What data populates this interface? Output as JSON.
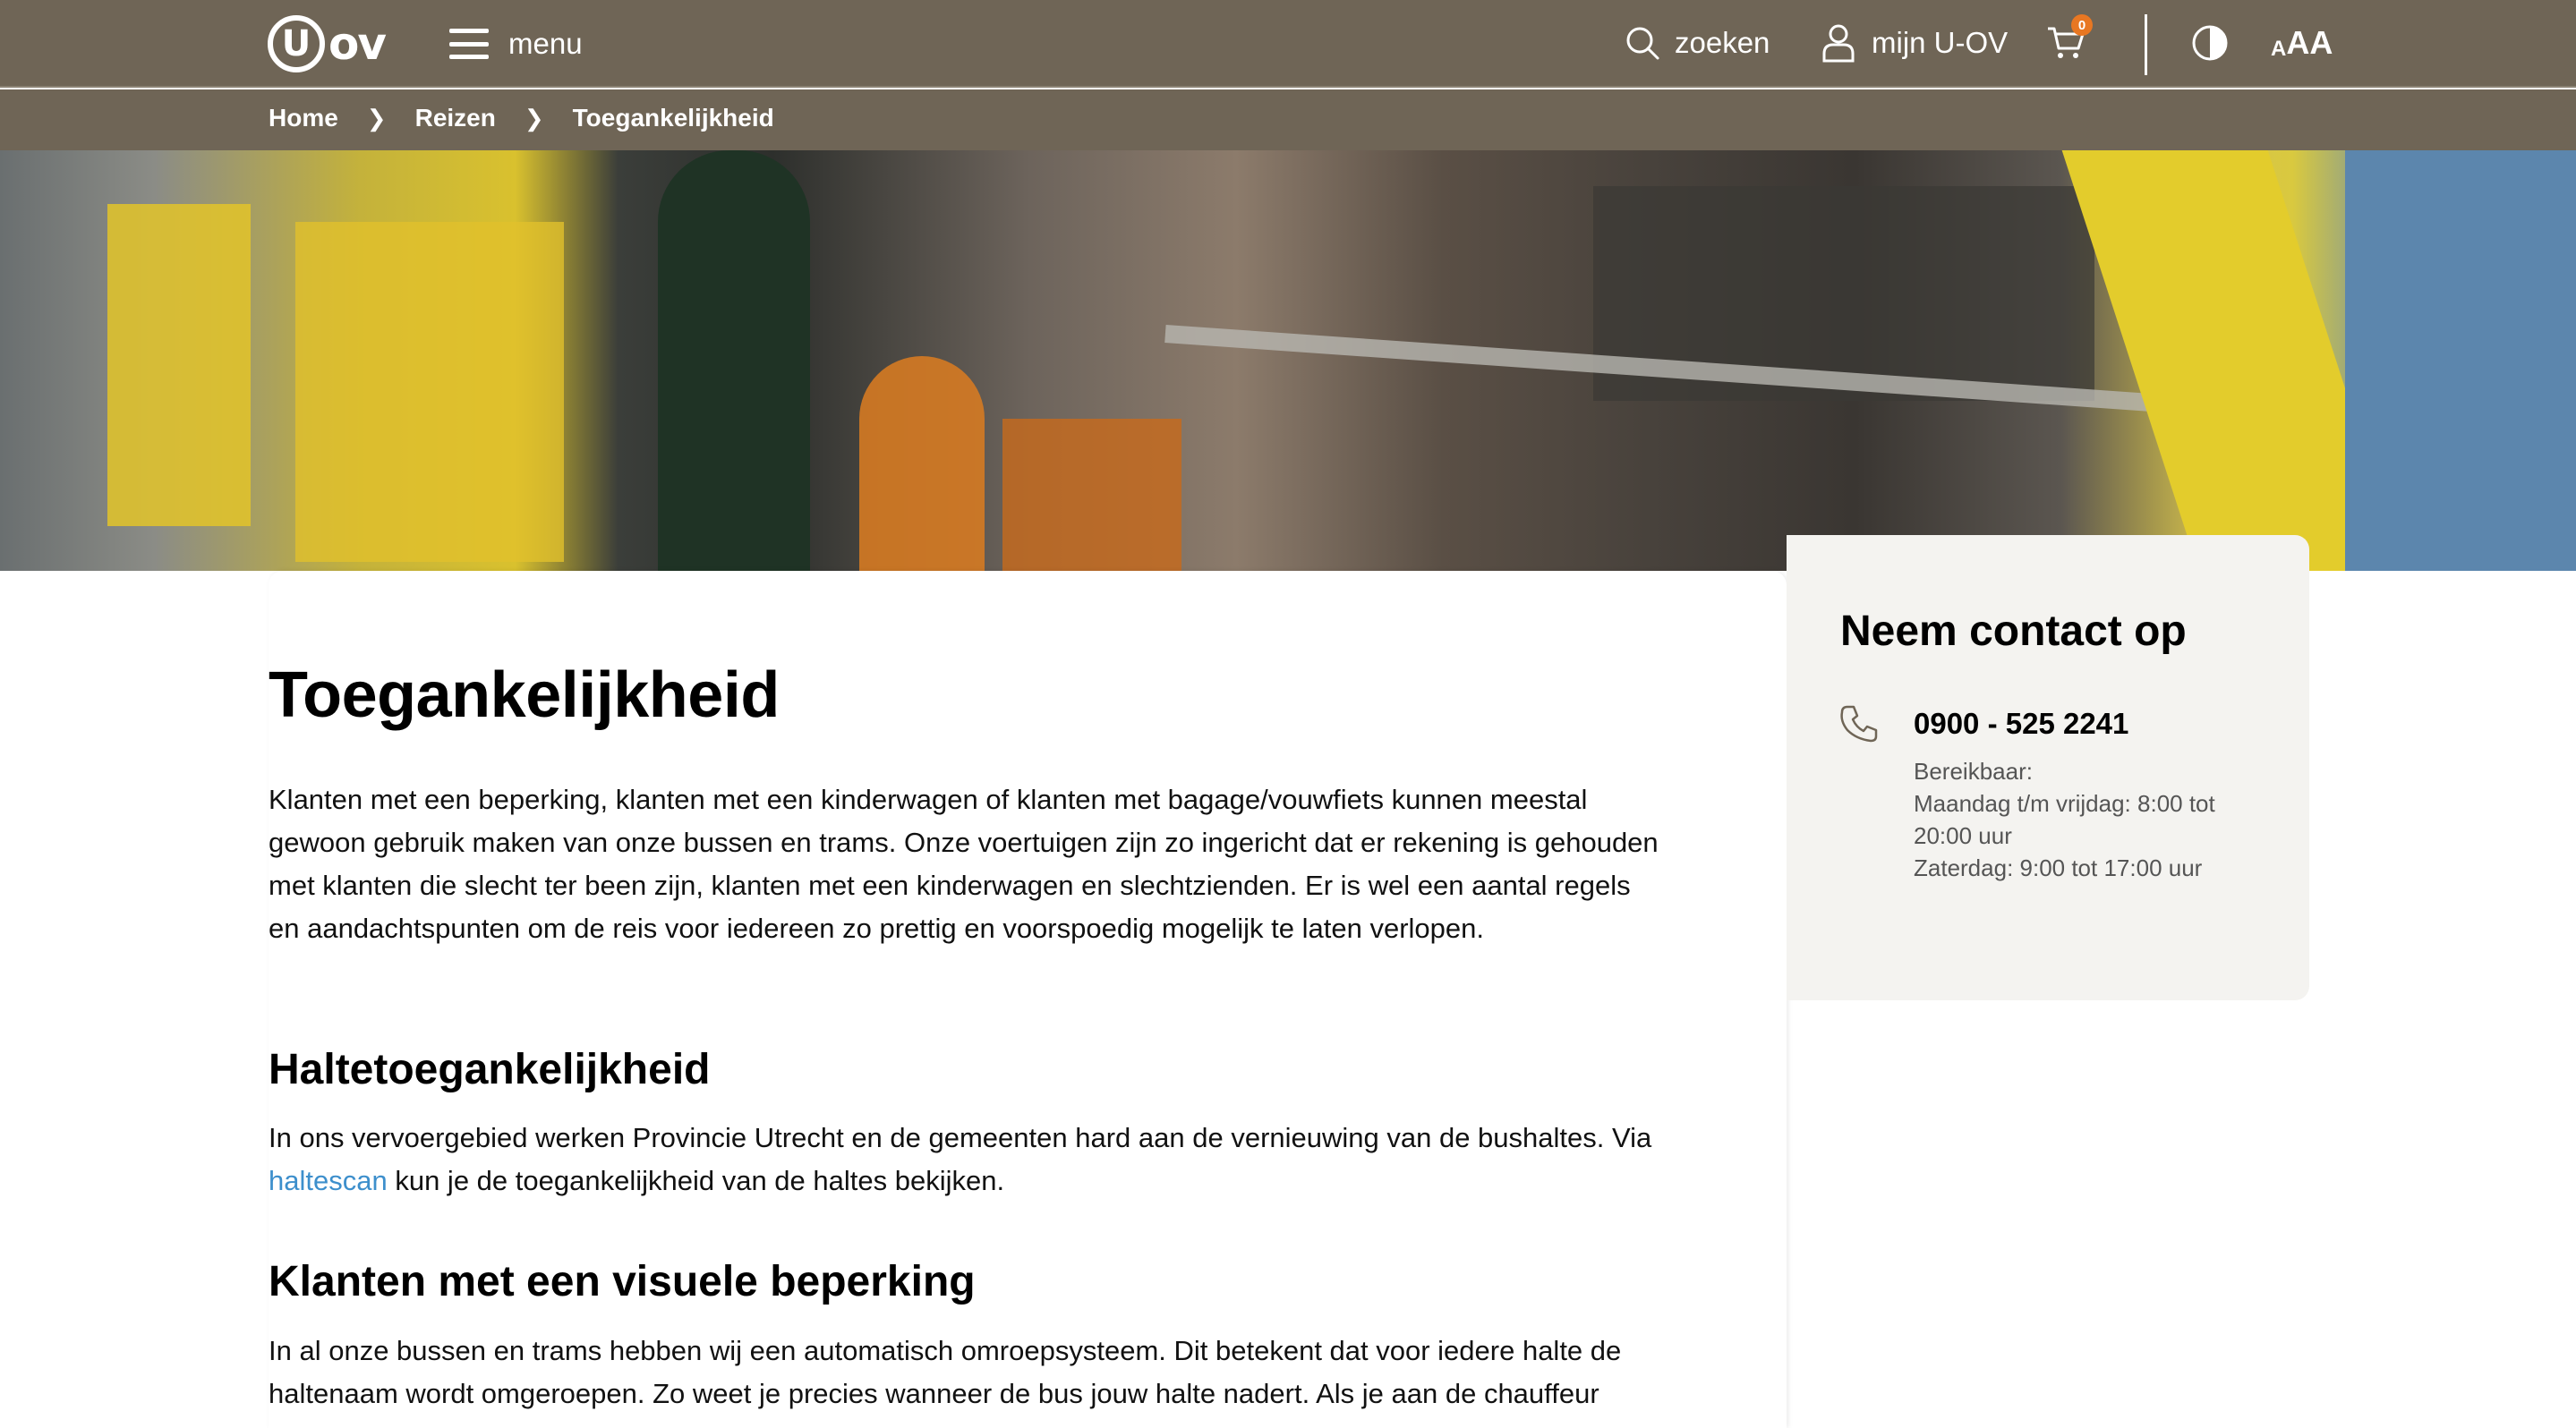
{
  "header": {
    "logo_u": "U",
    "logo_ov": "ov",
    "menu_label": "menu",
    "search_label": "zoeken",
    "account_label": "mijn U-OV",
    "cart_count": "0",
    "text_size_label": "AA",
    "icons": [
      "hamburger-icon",
      "search-icon",
      "user-icon",
      "cart-icon",
      "contrast-icon",
      "text-size-icon"
    ]
  },
  "breadcrumb": {
    "items": [
      "Home",
      "Reizen",
      "Toegankelijkheid"
    ],
    "separator": ">"
  },
  "main": {
    "title": "Toegankelijkheid",
    "intro": "Klanten met een beperking, klanten met een kinderwagen of klanten met bagage/vouwfiets kunnen meestal gewoon gebruik maken van onze bussen en trams. Onze voertuigen zijn zo ingericht dat er rekening is gehouden met klanten die slecht ter been zijn, klanten met een kinderwagen en slechtzienden. Er is wel een aantal regels en aandachtspunten om de reis voor iedereen zo prettig en voorspoedig mogelijk te laten verlopen.",
    "section1": {
      "heading": "Haltetoegankelijkheid",
      "text_before": "In ons vervoergebied werken Provincie Utrecht en de gemeenten hard aan de vernieuwing van de bushaltes. Via ",
      "link": "haltescan",
      "text_after": " kun je de toegankelijkheid van de haltes bekijken."
    },
    "section2": {
      "heading": "Klanten met een visuele beperking",
      "text": "In al onze bussen en trams hebben wij een automatisch omroepsysteem. Dit betekent dat voor iedere halte de haltenaam wordt omgeroepen. Zo weet je precies wanneer de bus jouw halte nadert. Als je aan de chauffeur"
    }
  },
  "contact": {
    "title": "Neem contact op",
    "phone": "0900 - 525 2241",
    "hours_label": "Bereikbaar:",
    "hours_weekdays": "Maandag t/m vrijdag: 8:00 tot 20:00 uur",
    "hours_saturday": "Zaterdag: 9:00 tot 17:00 uur"
  },
  "colors": {
    "header_bg": "#6f6556",
    "link": "#3d8fcc",
    "accent_orange": "#e87722",
    "sidebar_bg": "#f4f3f0"
  }
}
